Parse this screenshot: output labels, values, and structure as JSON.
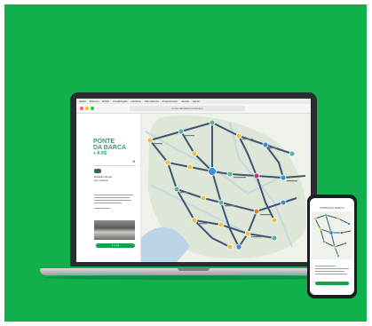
{
  "colors": {
    "background": "#10b04d",
    "brand_green": "#10a34a",
    "logo_teal": "#4a8f79",
    "line_navy": "#3e5572",
    "line_pale": "#c9d6e1",
    "stop_yellow": "#e8c34c",
    "stop_teal": "#5fb2a0",
    "stop_blue": "#3b8ed8",
    "stop_magenta": "#c1347b",
    "stop_orange": "#e07f2b"
  },
  "browser": {
    "menubar_items": [
      "Safari",
      "Ficheiro",
      "Editar",
      "Visualização",
      "Histórico",
      "Marcadores",
      "Programador",
      "Janela",
      "Ajuda"
    ],
    "url": "ponte-da-barca.vercel.app"
  },
  "panel": {
    "logo_line1": "PONTE",
    "logo_line2": "DA BARCA",
    "logo_line3": "+ A PÉ",
    "close_label": "×",
    "stop_name_line1": "Estação Abrigo",
    "stop_name_line2": "dos Castros",
    "button_label": "Ir a pé"
  },
  "icons": {
    "close": "close-icon",
    "stop": "bus-stop-icon",
    "photo": "landscape-photo"
  },
  "phone": {
    "title": "PONTE DA BARCA"
  }
}
